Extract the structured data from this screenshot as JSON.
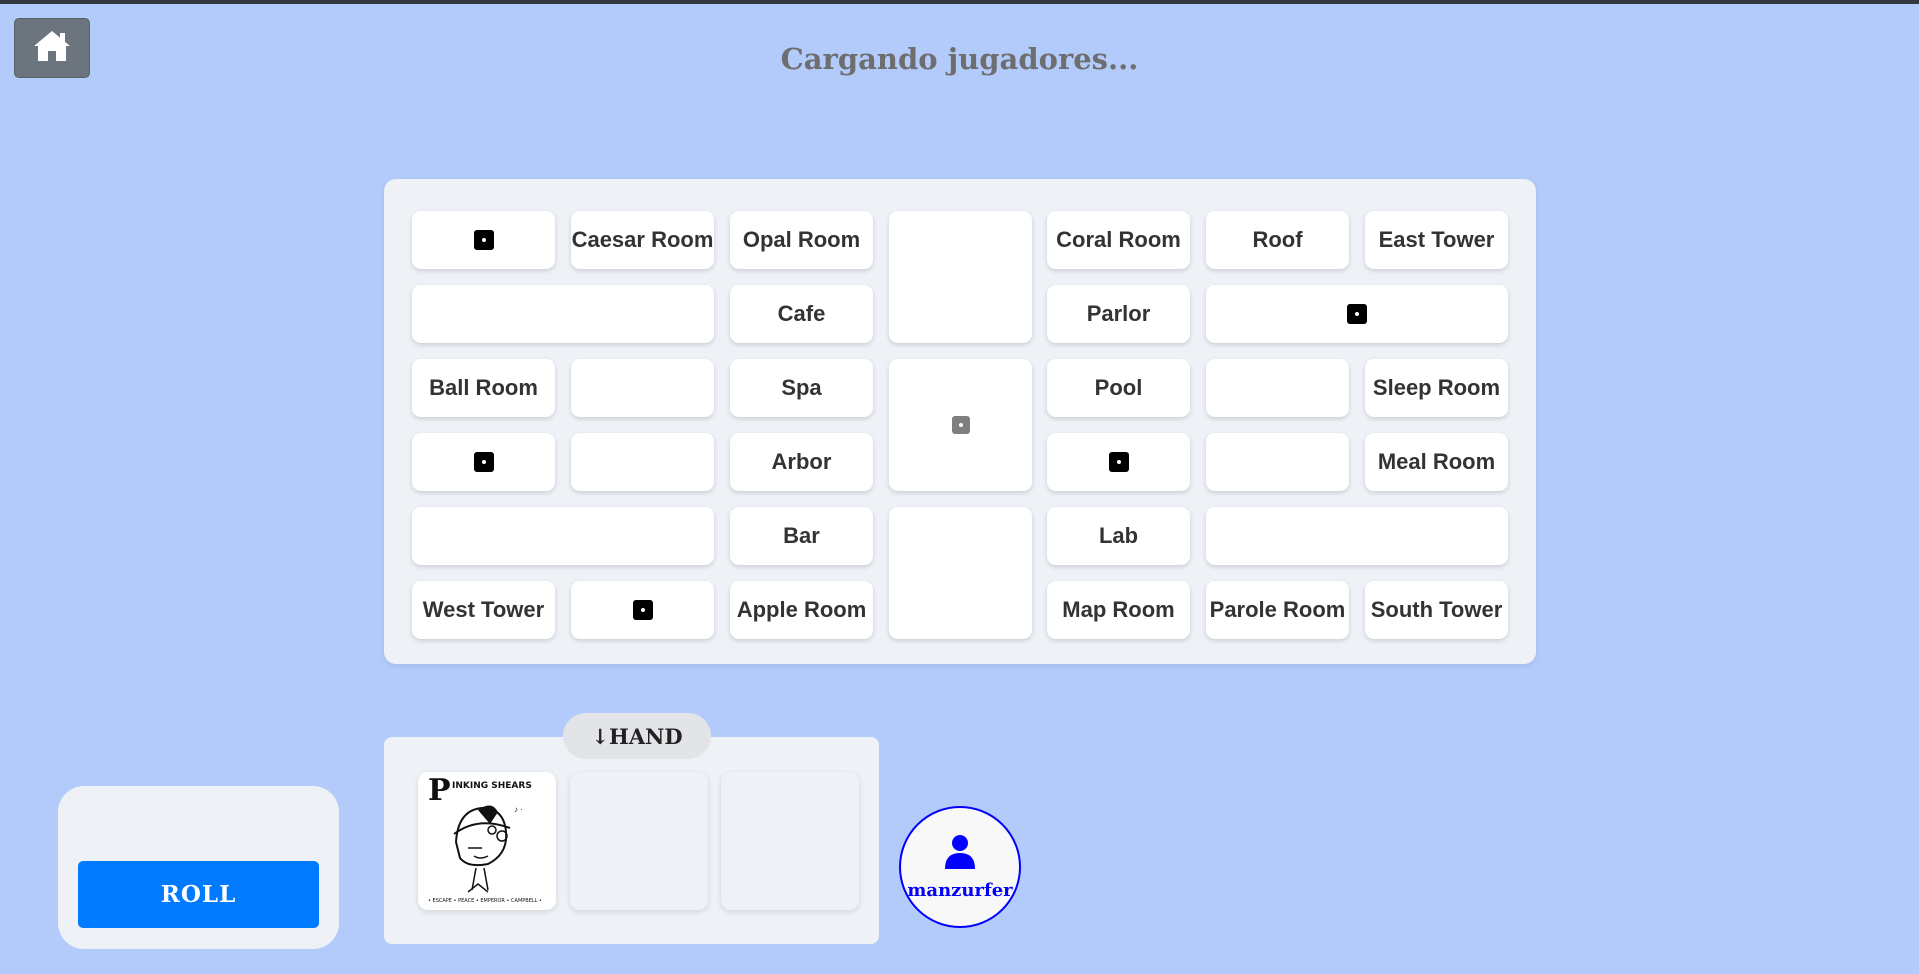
{
  "header": {
    "home_icon": "home-icon",
    "status_title": "Cargando jugadores..."
  },
  "board": {
    "rooms": {
      "caesar": "Caesar Room",
      "opal": "Opal Room",
      "coral": "Coral Room",
      "roof": "Roof",
      "east_tower": "East Tower",
      "cafe": "Cafe",
      "parlor": "Parlor",
      "ball": "Ball Room",
      "spa": "Spa",
      "pool": "Pool",
      "sleep": "Sleep Room",
      "arbor": "Arbor",
      "meal": "Meal Room",
      "bar": "Bar",
      "lab": "Lab",
      "west_tower": "West Tower",
      "apple": "Apple Room",
      "map": "Map Room",
      "parole": "Parole Room",
      "south_tower": "South Tower"
    },
    "secret_passage_icon": "dice-one-icon"
  },
  "controls": {
    "roll_label": "ROLL"
  },
  "hand": {
    "label": "↓HAND",
    "cards": [
      {
        "title": "INKING SHEARS",
        "initial": "P",
        "footer": "• ESCAPE • PEACE • EMPEROR • CAMPBELL •"
      },
      {
        "title": ""
      },
      {
        "title": ""
      }
    ]
  },
  "player": {
    "name": "manzurfer",
    "icon": "user-icon",
    "color": "#0000ff"
  },
  "colors": {
    "background": "#b3cbfb",
    "roll_button": "#007bff"
  }
}
